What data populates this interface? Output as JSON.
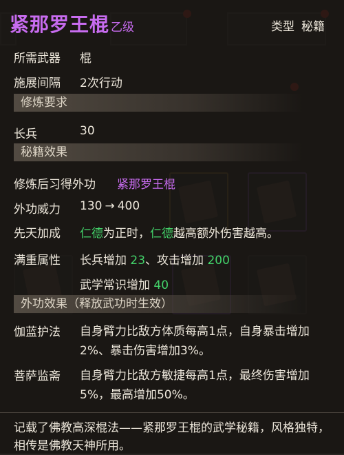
{
  "item": {
    "name": "紧那罗王棍",
    "grade": "乙级",
    "type_label": "类型",
    "type_value": "秘籍"
  },
  "requirements": [
    {
      "label": "所需武器",
      "value": "棍"
    },
    {
      "label": "施展间隔",
      "value": "2次行动"
    }
  ],
  "section_training": "修炼要求",
  "training": {
    "label": "长兵",
    "value": "30"
  },
  "section_effect": "秘籍效果",
  "effects": {
    "learn_label": "修炼后习得外功",
    "learn_value": "紧那罗王棍",
    "power_label": "外功威力",
    "power_from": "130",
    "power_arrow": "→",
    "power_to": "400",
    "innate_label": "先天加成",
    "innate_kw1": "仁德",
    "innate_text1": "为正时，",
    "innate_kw2": "仁德",
    "innate_text2": "越高额外伤害越高。",
    "fullweight_label": "满重属性",
    "fw_line1_a": "长兵增加 ",
    "fw_line1_a_val": "23",
    "fw_line1_b": "、攻击增加 ",
    "fw_line1_b_val": "200",
    "fw_line2_a": "武学常识增加 ",
    "fw_line2_a_val": "40"
  },
  "section_skill": "外功效果（释放武功时生效）",
  "skills": [
    {
      "label": "伽蓝护法",
      "text": "自身臂力比敌方体质每高1点，自身暴击增加2%、暴击伤害增加3%。"
    },
    {
      "label": "菩萨监斋",
      "text": "自身臂力比敌方敏捷每高1点，最终伤害增加5%，最高增加50%。"
    }
  ],
  "footer": "记载了佛教高深棍法——紧那罗王棍的武学秘籍，风格独特，相传是佛教天神所用。",
  "colors": {
    "title": "#c86cf0",
    "highlight": "#43d36a",
    "text": "#ece6da"
  }
}
